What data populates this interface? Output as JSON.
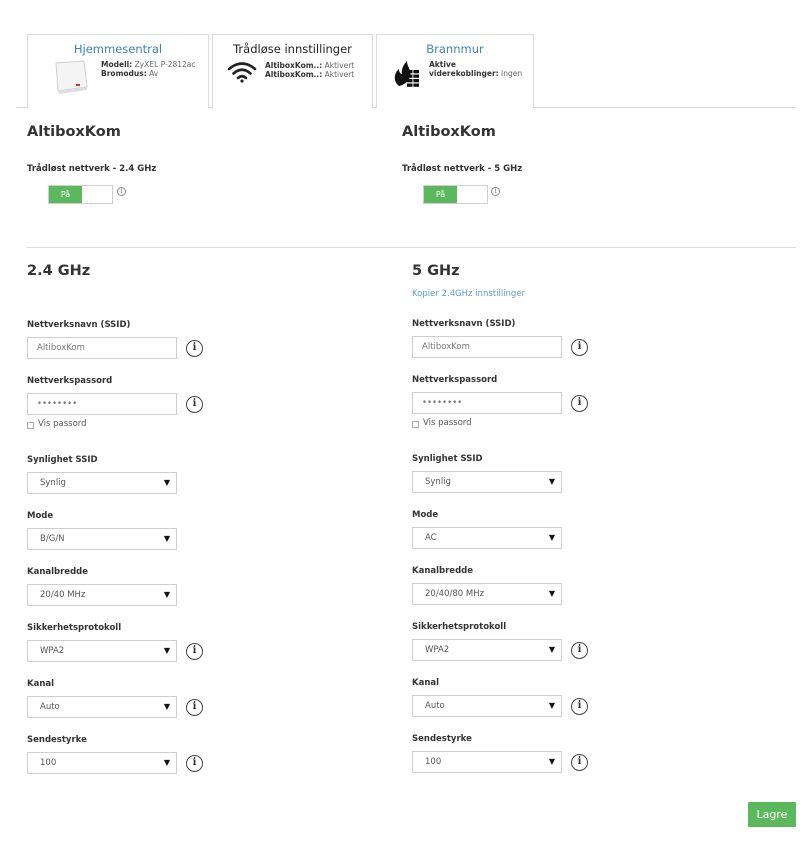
{
  "tabs": [
    {
      "title": "Hjemmesentral",
      "rows": [
        {
          "k": "Modell:",
          "v": "ZyXEL P-2812ac"
        },
        {
          "k": "Bromodus:",
          "v": "Av"
        }
      ]
    },
    {
      "title": "Trådløse innstillinger",
      "rows": [
        {
          "k": "AltiboxKom..:",
          "v": "Aktivert"
        },
        {
          "k": "AltiboxKom..:",
          "v": "Aktivert"
        }
      ]
    },
    {
      "title": "Brannmur",
      "rows": [
        {
          "k": "Aktive",
          "v": ""
        },
        {
          "k": "viderekoblinger:",
          "v": "Ingen"
        }
      ]
    }
  ],
  "networks": [
    {
      "ssid": "AltiboxKom",
      "label": "Trådløst nettverk - 2.4 GHz",
      "toggle": "På"
    },
    {
      "ssid": "AltiboxKom",
      "label": "Trådløst nettverk - 5 GHz",
      "toggle": "På"
    }
  ],
  "info_glyph": "i",
  "bands": [
    {
      "title": "2.4 GHz",
      "copy_link": "",
      "ssid_label": "Nettverksnavn (SSID)",
      "ssid_value": "AltiboxKom",
      "pw_label": "Nettverkspassord",
      "pw_value": "••••••••",
      "show_pw": "Vis passord",
      "visibility_label": "Synlighet SSID",
      "visibility_value": "Synlig",
      "mode_label": "Mode",
      "mode_value": "B/G/N",
      "width_label": "Kanalbredde",
      "width_value": "20/40 MHz",
      "security_label": "Sikkerhetsprotokoll",
      "security_value": "WPA2",
      "channel_label": "Kanal",
      "channel_value": "Auto",
      "power_label": "Sendestyrke",
      "power_value": "100"
    },
    {
      "title": "5 GHz",
      "copy_link": "Kopier 2.4GHz innstillinger",
      "ssid_label": "Nettverksnavn (SSID)",
      "ssid_value": "AltiboxKom",
      "pw_label": "Nettverkspassord",
      "pw_value": "••••••••",
      "show_pw": "Vis passord",
      "visibility_label": "Synlighet SSID",
      "visibility_value": "Synlig",
      "mode_label": "Mode",
      "mode_value": "AC",
      "width_label": "Kanalbredde",
      "width_value": "20/40/80 MHz",
      "security_label": "Sikkerhetsprotokoll",
      "security_value": "WPA2",
      "channel_label": "Kanal",
      "channel_value": "Auto",
      "power_label": "Sendestyrke",
      "power_value": "100"
    }
  ],
  "save_label": "Lagre",
  "colors": {
    "accent_green": "#5cb85c",
    "link_blue": "#3a86b8"
  }
}
